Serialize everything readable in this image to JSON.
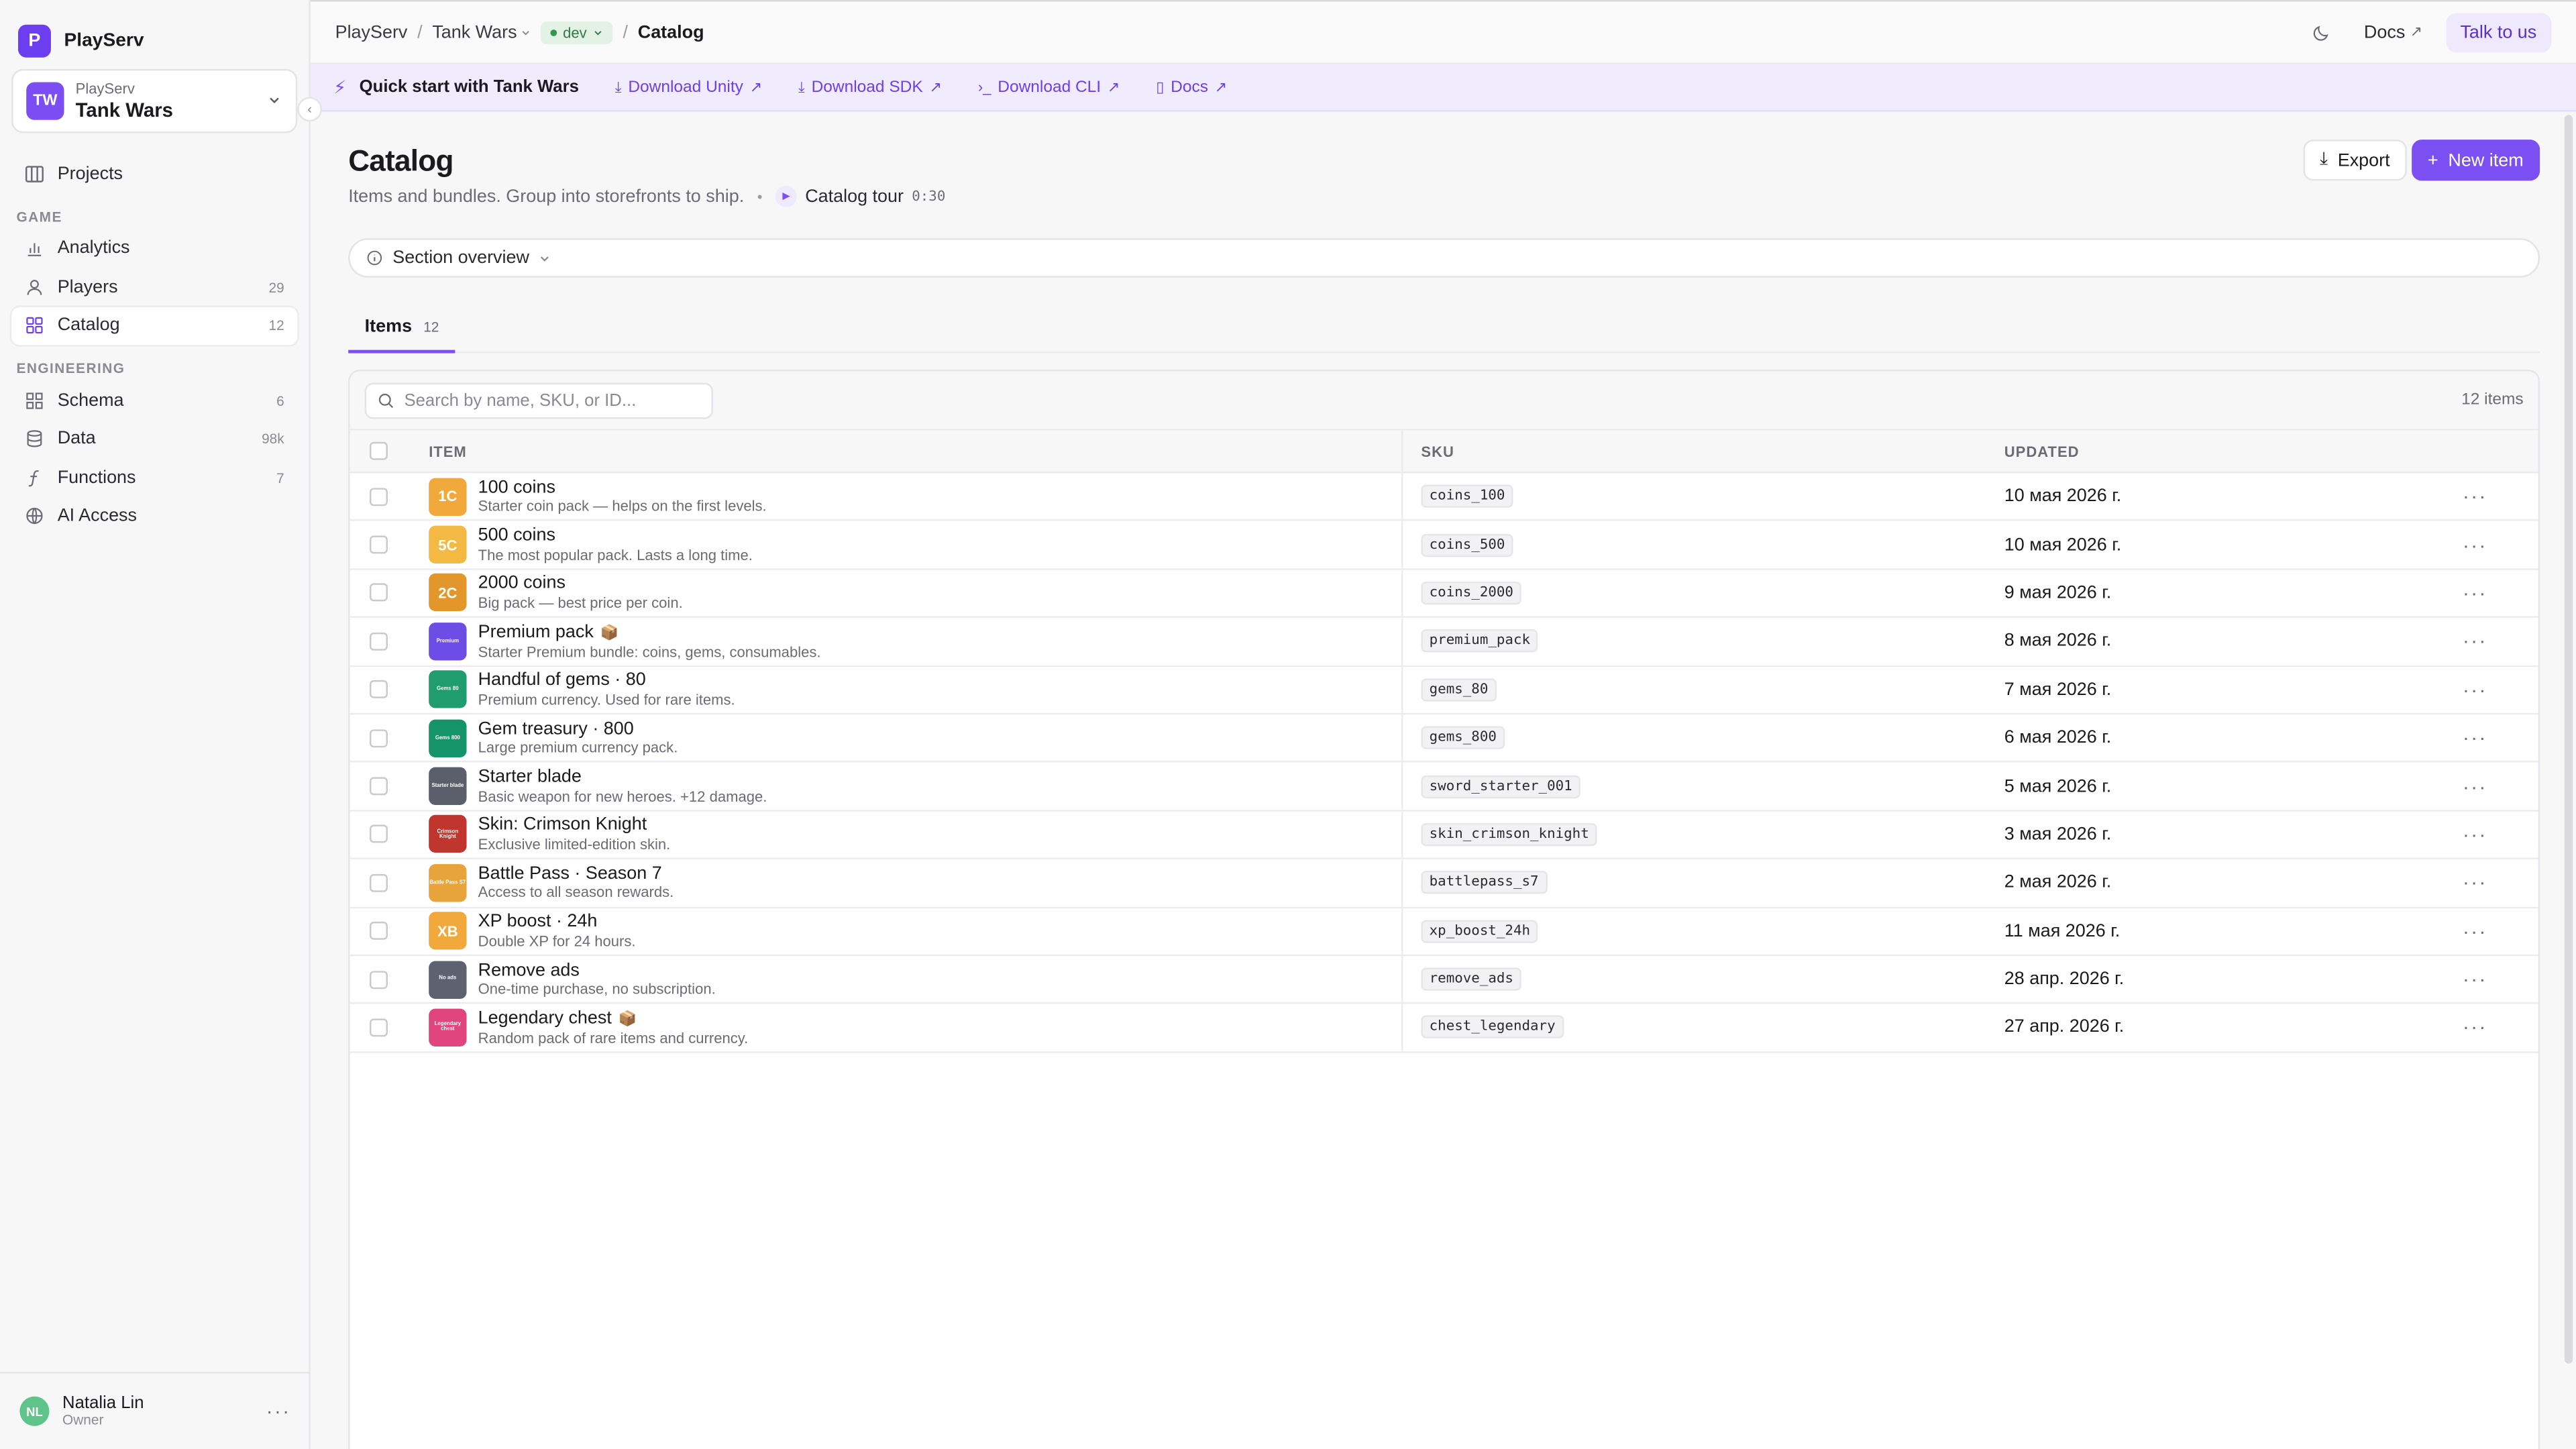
{
  "brand": {
    "logo_letter": "P",
    "name": "PlayServ"
  },
  "project": {
    "avatar": "TW",
    "org": "PlayServ",
    "name": "Tank Wars"
  },
  "sidebar": {
    "projects_label": "Projects",
    "section_game": "GAME",
    "section_engineering": "ENGINEERING",
    "game_items": [
      {
        "label": "Analytics",
        "count": "",
        "icon": "bar-chart-icon"
      },
      {
        "label": "Players",
        "count": "29",
        "icon": "user-icon"
      },
      {
        "label": "Catalog",
        "count": "12",
        "icon": "grid-icon",
        "active": true
      }
    ],
    "engineering_items": [
      {
        "label": "Schema",
        "count": "6",
        "icon": "schema-icon"
      },
      {
        "label": "Data",
        "count": "98k",
        "icon": "database-icon"
      },
      {
        "label": "Functions",
        "count": "7",
        "icon": "function-icon"
      },
      {
        "label": "AI Access",
        "count": "",
        "icon": "globe-icon"
      }
    ]
  },
  "user": {
    "initials": "NL",
    "name": "Natalia Lin",
    "role": "Owner"
  },
  "topbar": {
    "crumb_org": "PlayServ",
    "crumb_project": "Tank Wars",
    "env": "dev",
    "crumb_page": "Catalog",
    "docs_label": "Docs",
    "talk_label": "Talk to us"
  },
  "quickstart": {
    "title": "Quick start with Tank Wars",
    "links": [
      "Download Unity",
      "Download SDK",
      "Download CLI",
      "Docs"
    ]
  },
  "page": {
    "title": "Catalog",
    "subtitle": "Items and bundles. Group into storefronts to ship.",
    "tour_label": "Catalog tour",
    "tour_time": "0:30",
    "export_label": "Export",
    "new_label": "New item",
    "section_overview": "Section overview"
  },
  "tabs": [
    {
      "label": "Items",
      "count": "12"
    }
  ],
  "table": {
    "search_placeholder": "Search by name, SKU, or ID...",
    "count_label": "12 items",
    "headers": {
      "item": "ITEM",
      "sku": "SKU",
      "updated": "UPDATED"
    },
    "rows": [
      {
        "thumb": "1C",
        "thumb_color": "#f2a93b",
        "name": "100 coins",
        "desc": "Starter coin pack — helps on the first levels.",
        "sku": "coins_100",
        "updated": "10 мая 2026 г.",
        "bundle": false
      },
      {
        "thumb": "5C",
        "thumb_color": "#f4b942",
        "name": "500 coins",
        "desc": "The most popular pack. Lasts a long time.",
        "sku": "coins_500",
        "updated": "10 мая 2026 г.",
        "bundle": false
      },
      {
        "thumb": "2C",
        "thumb_color": "#e3962a",
        "name": "2000 coins",
        "desc": "Big pack — best price per coin.",
        "sku": "coins_2000",
        "updated": "9 мая 2026 г.",
        "bundle": false
      },
      {
        "thumb": "Premium",
        "thumb_color": "#6d4de6",
        "name": "Premium pack",
        "desc": "Starter Premium bundle: coins, gems, consumables.",
        "sku": "premium_pack",
        "updated": "8 мая 2026 г.",
        "bundle": true,
        "tiny": true
      },
      {
        "thumb": "Gems 80",
        "thumb_color": "#1f9d6e",
        "name": "Handful of gems · 80",
        "desc": "Premium currency. Used for rare items.",
        "sku": "gems_80",
        "updated": "7 мая 2026 г.",
        "bundle": false,
        "tiny": true
      },
      {
        "thumb": "Gems 800",
        "thumb_color": "#15946a",
        "name": "Gem treasury · 800",
        "desc": "Large premium currency pack.",
        "sku": "gems_800",
        "updated": "6 мая 2026 г.",
        "bundle": false,
        "tiny": true
      },
      {
        "thumb": "Starter blade",
        "thumb_color": "#5b5f6b",
        "name": "Starter blade",
        "desc": "Basic weapon for new heroes. +12 damage.",
        "sku": "sword_starter_001",
        "updated": "5 мая 2026 г.",
        "bundle": false,
        "tiny": true
      },
      {
        "thumb": "Crimson Knight",
        "thumb_color": "#c0352e",
        "name": "Skin: Crimson Knight",
        "desc": "Exclusive limited-edition skin.",
        "sku": "skin_crimson_knight",
        "updated": "3 мая 2026 г.",
        "bundle": false,
        "tiny": true
      },
      {
        "thumb": "Battle Pass S7",
        "thumb_color": "#e8a43a",
        "name": "Battle Pass · Season 7",
        "desc": "Access to all season rewards.",
        "sku": "battlepass_s7",
        "updated": "2 мая 2026 г.",
        "bundle": false,
        "tiny": true
      },
      {
        "thumb": "XB",
        "thumb_color": "#f0a93a",
        "name": "XP boost · 24h",
        "desc": "Double XP for 24 hours.",
        "sku": "xp_boost_24h",
        "updated": "11 мая 2026 г.",
        "bundle": false
      },
      {
        "thumb": "No ads",
        "thumb_color": "#5d6170",
        "name": "Remove ads",
        "desc": "One-time purchase, no subscription.",
        "sku": "remove_ads",
        "updated": "28 апр. 2026 г.",
        "bundle": false,
        "tiny": true
      },
      {
        "thumb": "Legendary chest",
        "thumb_color": "#e0457e",
        "name": "Legendary chest",
        "desc": "Random pack of rare items and currency.",
        "sku": "chest_legendary",
        "updated": "27 апр. 2026 г.",
        "bundle": true,
        "tiny": true
      }
    ]
  }
}
